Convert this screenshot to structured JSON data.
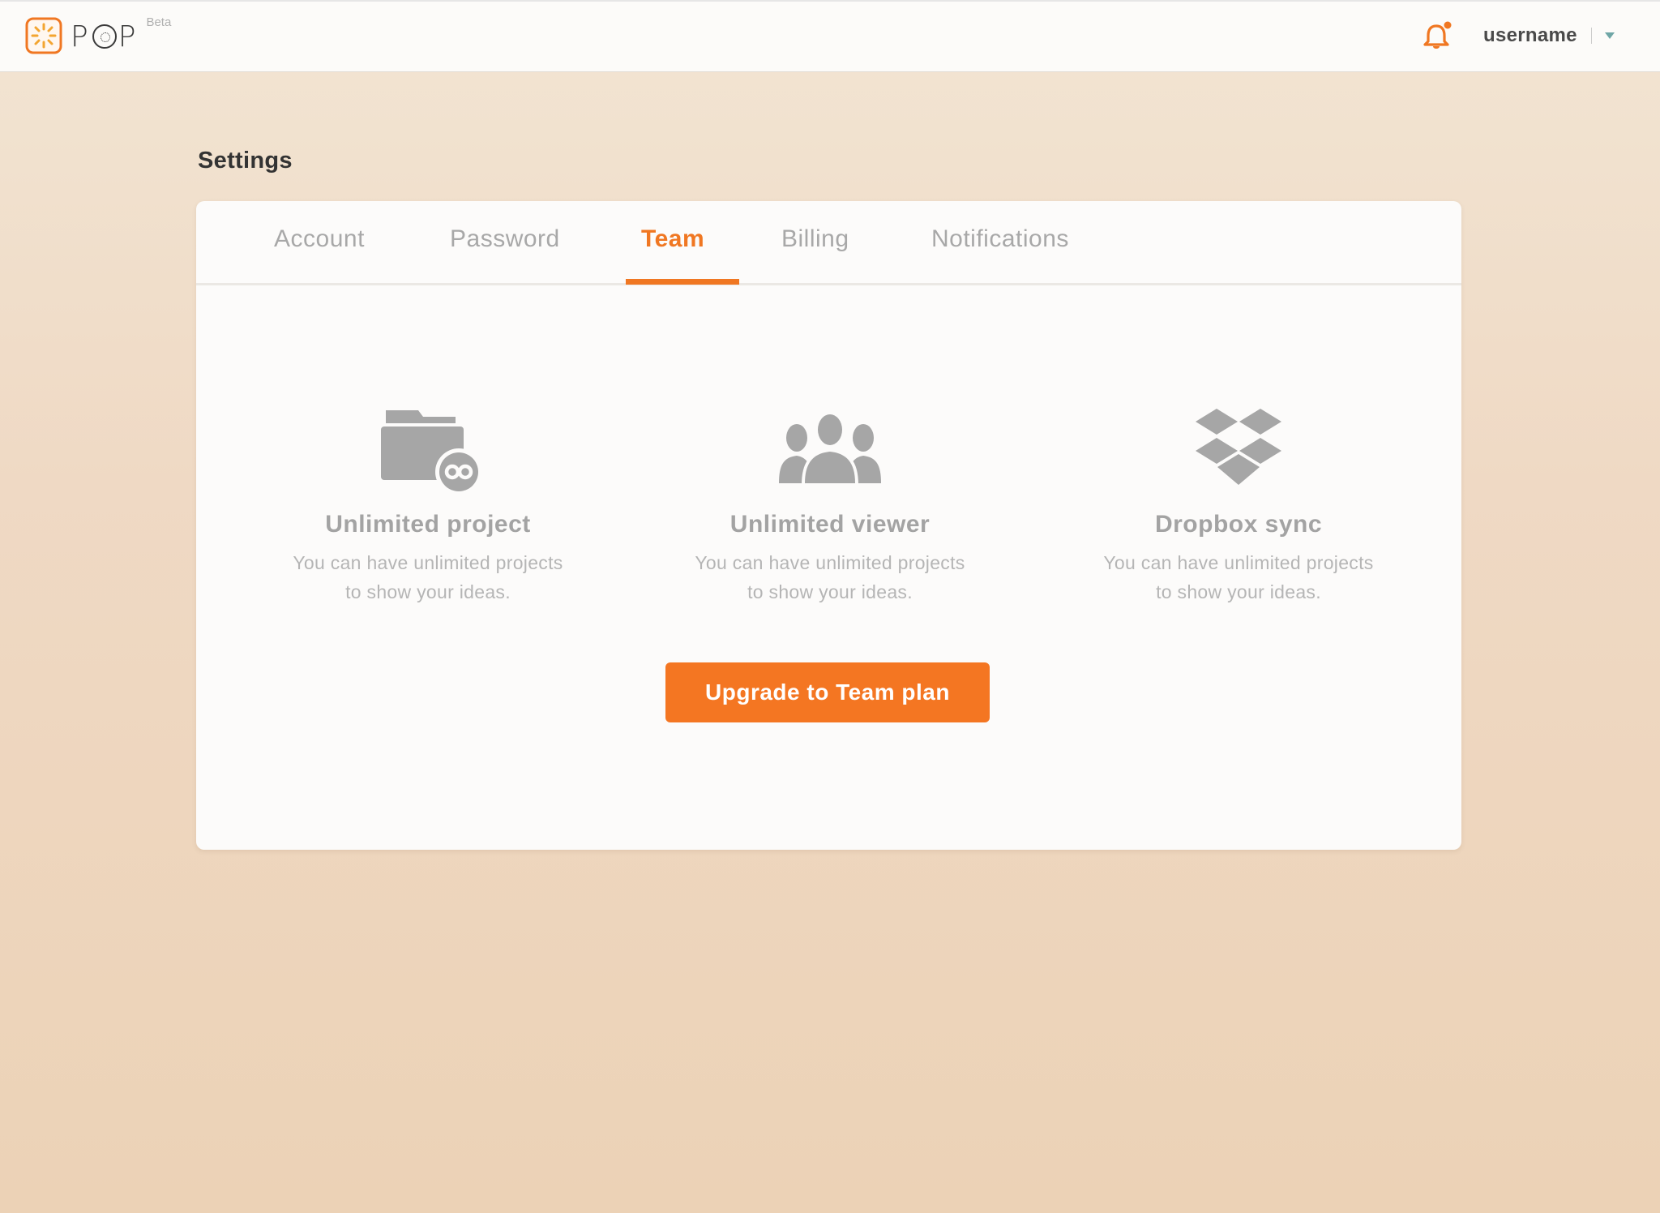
{
  "header": {
    "logo_text_p1": "P",
    "logo_text_p2": "P",
    "beta_label": "Beta",
    "username": "username",
    "icons": {
      "logo": "pop-logo-icon",
      "notifications": "bell-icon",
      "user_menu": "chevron-down-icon"
    }
  },
  "page": {
    "title": "Settings"
  },
  "tabs": [
    {
      "label": "Account",
      "active": false
    },
    {
      "label": "Password",
      "active": false
    },
    {
      "label": "Team",
      "active": true
    },
    {
      "label": "Billing",
      "active": false
    },
    {
      "label": "Notifications",
      "active": false
    }
  ],
  "features": [
    {
      "icon": "folder-infinity-icon",
      "title": "Unlimited project",
      "desc_line1": "You can have unlimited projects",
      "desc_line2": "to show your ideas."
    },
    {
      "icon": "users-group-icon",
      "title": "Unlimited viewer",
      "desc_line1": "You can have unlimited projects",
      "desc_line2": "to show your ideas."
    },
    {
      "icon": "dropbox-icon",
      "title": "Dropbox sync",
      "desc_line1": "You can have unlimited projects",
      "desc_line2": "to show your ideas."
    }
  ],
  "cta": {
    "label": "Upgrade to Team plan"
  },
  "colors": {
    "accent": "#f07722",
    "button": "#f47622",
    "icon_gray": "#a6a6a6",
    "text_dark": "#333333"
  }
}
